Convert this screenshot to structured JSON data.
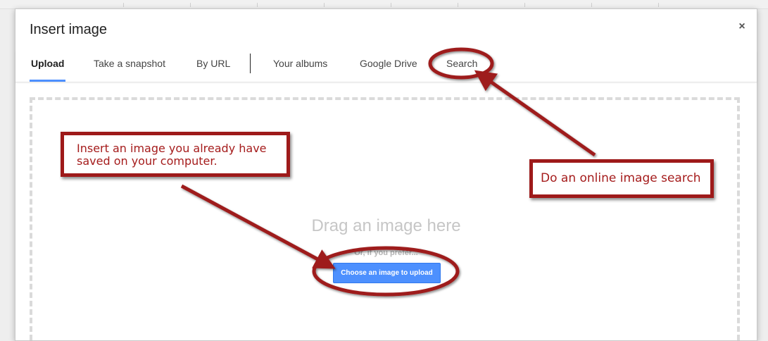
{
  "dialog": {
    "title": "Insert image",
    "close_label": "×"
  },
  "tabs": [
    {
      "label": "Upload",
      "active": true
    },
    {
      "label": "Take a snapshot",
      "active": false
    },
    {
      "label": "By URL",
      "active": false
    },
    {
      "label": "Your albums",
      "active": false
    },
    {
      "label": "Google Drive",
      "active": false
    },
    {
      "label": "Search",
      "active": false
    }
  ],
  "upload": {
    "drag_text": "Drag an image here",
    "prefer_text": "Or, if you prefer...",
    "button_label": "Choose an image to upload"
  },
  "annotations": {
    "upload_callout": "Insert an image you already have saved on your computer.",
    "search_callout": "Do an online image search"
  },
  "colors": {
    "accent_blue": "#4d90fe",
    "annotation_red": "#9e1a1a"
  }
}
